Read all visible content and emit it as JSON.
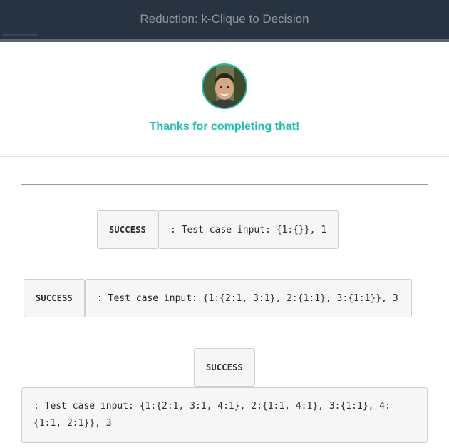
{
  "header": {
    "title": "Reduction: k-Clique to Decision"
  },
  "modal": {
    "avatar_icon": "user-avatar-photo",
    "thanks_text": "Thanks for completing that!",
    "accent_color": "#1fbfae"
  },
  "results": [
    {
      "status": "SUCCESS",
      "message": ": Test case input: {1:{}}, 1"
    },
    {
      "status": "SUCCESS",
      "message": ": Test case input: {1:{2:1, 3:1}, 2:{1:1}, 3:{1:1}}, 3"
    },
    {
      "status": "SUCCESS",
      "message": ": Test case input: {1:{2:1, 3:1, 4:1}, 2:{1:1, 4:1}, 3:{1:1}, 4:{1:1, 2:1}}, 3"
    }
  ]
}
